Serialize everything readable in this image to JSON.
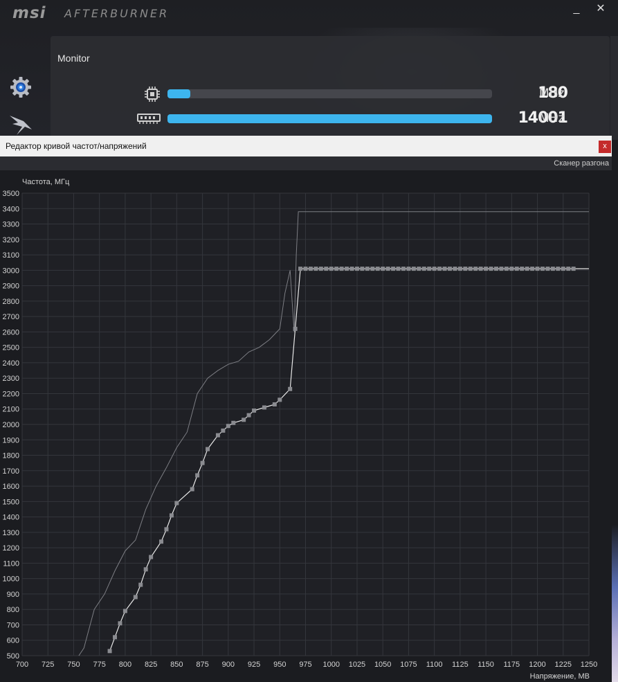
{
  "app": {
    "brand": "msi",
    "name": "AFTERBURNER",
    "window_controls": {
      "minimize": "_",
      "close": "✕"
    }
  },
  "sidebar": {
    "items": [
      {
        "icon": "gear-icon"
      },
      {
        "icon": "oc-scanner-icon"
      }
    ]
  },
  "monitor": {
    "title": "Monitor",
    "rows": [
      {
        "icon": "gpu-chip-icon",
        "value": "180",
        "unit": "MHz",
        "fill_fraction": 0.07
      },
      {
        "icon": "memory-module-icon",
        "value": "14001",
        "unit": "MHz",
        "fill_fraction": 1.0
      }
    ],
    "accent_color": "#3db5ee"
  },
  "editor": {
    "title": "Редактор кривой частот/напряжений",
    "close_label": "x",
    "scanner_label": "Сканер разгона"
  },
  "chart_data": {
    "type": "line",
    "ylabel": "Частота, МГц",
    "xlabel": "Напряжение, МВ",
    "xlim": [
      700,
      1250
    ],
    "ylim": [
      500,
      3500
    ],
    "x_ticks": [
      700,
      725,
      750,
      775,
      800,
      825,
      850,
      875,
      900,
      925,
      950,
      975,
      1000,
      1025,
      1050,
      1075,
      1100,
      1125,
      1150,
      1175,
      1200,
      1225,
      1250
    ],
    "y_ticks": [
      500,
      600,
      700,
      800,
      900,
      1000,
      1100,
      1200,
      1300,
      1400,
      1500,
      1600,
      1700,
      1800,
      1900,
      2000,
      2100,
      2200,
      2300,
      2400,
      2500,
      2600,
      2700,
      2800,
      2900,
      3000,
      3100,
      3200,
      3300,
      3400,
      3500
    ],
    "grid": true,
    "series": [
      {
        "role": "reference",
        "color": "#7d7e84",
        "x": [
          755,
          760,
          770,
          780,
          790,
          800,
          810,
          820,
          830,
          840,
          850,
          860,
          870,
          880,
          890,
          900,
          910,
          920,
          930,
          940,
          950,
          955,
          960,
          962,
          964,
          966,
          968,
          970,
          980,
          1000,
          1050,
          1100,
          1150,
          1200,
          1250
        ],
        "y": [
          500,
          550,
          800,
          900,
          1050,
          1180,
          1250,
          1450,
          1600,
          1720,
          1850,
          1950,
          2200,
          2300,
          2350,
          2390,
          2410,
          2470,
          2500,
          2550,
          2620,
          2850,
          3000,
          2800,
          2600,
          3100,
          3380,
          3380,
          3380,
          3380,
          3380,
          3380,
          3380,
          3380,
          3380
        ]
      },
      {
        "role": "curve",
        "color": "#e8e8e8",
        "marker_color": "#8a8b90",
        "x": [
          785,
          790,
          795,
          800,
          810,
          815,
          820,
          825,
          835,
          840,
          845,
          850,
          865,
          870,
          875,
          880,
          890,
          895,
          900,
          905,
          915,
          920,
          925,
          935,
          945,
          950,
          960,
          965,
          970,
          975,
          980,
          985,
          990,
          995,
          1000,
          1005,
          1010,
          1015,
          1020,
          1025,
          1030,
          1035,
          1040,
          1045,
          1050,
          1055,
          1060,
          1065,
          1070,
          1075,
          1080,
          1085,
          1090,
          1095,
          1100,
          1105,
          1110,
          1115,
          1120,
          1125,
          1130,
          1135,
          1140,
          1145,
          1150,
          1155,
          1160,
          1165,
          1170,
          1175,
          1180,
          1185,
          1190,
          1195,
          1200,
          1205,
          1210,
          1215,
          1220,
          1225,
          1230,
          1235
        ],
        "y": [
          530,
          620,
          710,
          790,
          880,
          960,
          1060,
          1140,
          1240,
          1320,
          1410,
          1490,
          1580,
          1670,
          1750,
          1840,
          1930,
          1960,
          1990,
          2010,
          2030,
          2060,
          2090,
          2110,
          2130,
          2160,
          2230,
          2620,
          3010,
          3010,
          3010,
          3010,
          3010,
          3010,
          3010,
          3010,
          3010,
          3010,
          3010,
          3010,
          3010,
          3010,
          3010,
          3010,
          3010,
          3010,
          3010,
          3010,
          3010,
          3010,
          3010,
          3010,
          3010,
          3010,
          3010,
          3010,
          3010,
          3010,
          3010,
          3010,
          3010,
          3010,
          3010,
          3010,
          3010,
          3010,
          3010,
          3010,
          3010,
          3010,
          3010,
          3010,
          3010,
          3010,
          3010,
          3010,
          3010,
          3010,
          3010,
          3010,
          3010,
          3010
        ]
      }
    ]
  }
}
